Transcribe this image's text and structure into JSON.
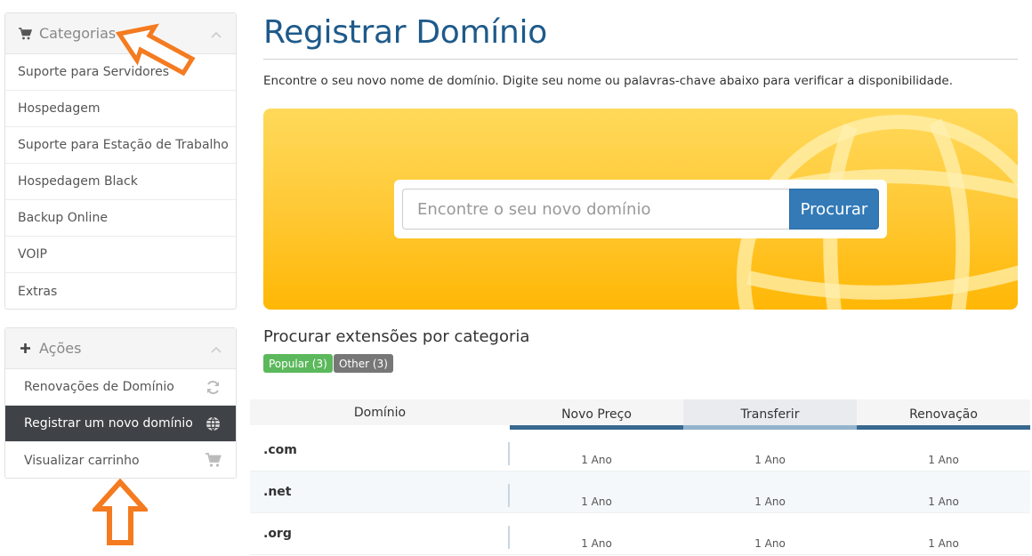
{
  "sidebar": {
    "categories": {
      "title": "Categorias",
      "items": [
        {
          "label": "Suporte para Servidores"
        },
        {
          "label": "Hospedagem"
        },
        {
          "label": "Suporte para Estação de Trabalho"
        },
        {
          "label": "Hospedagem Black"
        },
        {
          "label": "Backup Online"
        },
        {
          "label": "VOIP"
        },
        {
          "label": "Extras"
        }
      ]
    },
    "actions": {
      "title": "Ações",
      "items": [
        {
          "label": "Renovações de Domínio",
          "icon": "refresh-icon"
        },
        {
          "label": "Registrar um novo domínio",
          "icon": "globe-icon",
          "active": true
        },
        {
          "label": "Visualizar carrinho",
          "icon": "cart-icon"
        }
      ]
    }
  },
  "main": {
    "title": "Registrar Domínio",
    "intro": "Encontre o seu novo nome de domínio. Digite seu nome ou palavras-chave abaixo para verificar a disponibilidade.",
    "search": {
      "placeholder": "Encontre o seu novo domínio",
      "button": "Procurar"
    },
    "extensions_title": "Procurar extensões por categoria",
    "tags": [
      {
        "label": "Popular (3)",
        "color": "#5cb85c"
      },
      {
        "label": "Other (3)",
        "color": "#777777"
      }
    ]
  },
  "table": {
    "headers": [
      "Domínio",
      "Novo Preço",
      "Transferir",
      "Renovação"
    ],
    "rows": [
      {
        "domain": ".com",
        "new": "1 Ano",
        "transfer": "1 Ano",
        "renew": "1 Ano"
      },
      {
        "domain": ".net",
        "new": "1 Ano",
        "transfer": "1 Ano",
        "renew": "1 Ano"
      },
      {
        "domain": ".org",
        "new": "1 Ano",
        "transfer": "1 Ano",
        "renew": "1 Ano"
      }
    ]
  },
  "colors": {
    "title_blue": "#1e5a8a",
    "button_blue": "#337ab7",
    "hero_yellow": "#ffc936",
    "arrow_orange": "#f47b20",
    "active_item": "#3f4246"
  }
}
